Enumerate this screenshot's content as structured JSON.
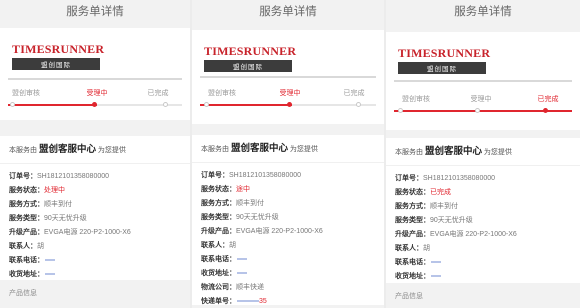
{
  "page": {
    "title": "服务单详情"
  },
  "logo": {
    "brand": "TIMESRUNNER",
    "sub": "盟创国际"
  },
  "steps": [
    "盟创审核",
    "受理中",
    "已完成"
  ],
  "provider": {
    "prefix": "本服务由",
    "name": "盟创客服中心",
    "suffix": "为您提供"
  },
  "labels": {
    "order_no": "订单号：",
    "status": "服务状态：",
    "method": "服务方式：",
    "type": "服务类型：",
    "product": "升级产品：",
    "contact": "联系人：",
    "phone": "联系电话：",
    "address": "收货地址：",
    "logistics": "物流公司：",
    "tracking": "快递单号："
  },
  "values": {
    "order_no": "SH1812101358080000",
    "method": "顺丰到付",
    "type": "90天无忧升级",
    "product": "EVGA电源 220-P2-1000-X6",
    "contact": "胡",
    "logistics": "顺丰快递",
    "tracking_tail": "35"
  },
  "panels": [
    {
      "status": "处理中",
      "progress": 0.5,
      "active_step": 1,
      "extra": "产品信息"
    },
    {
      "status": "途中",
      "progress": 0.5,
      "active_step": 1
    },
    {
      "status": "已完成",
      "progress": 1.0,
      "active_step": 2,
      "extra": "产品信息"
    }
  ]
}
